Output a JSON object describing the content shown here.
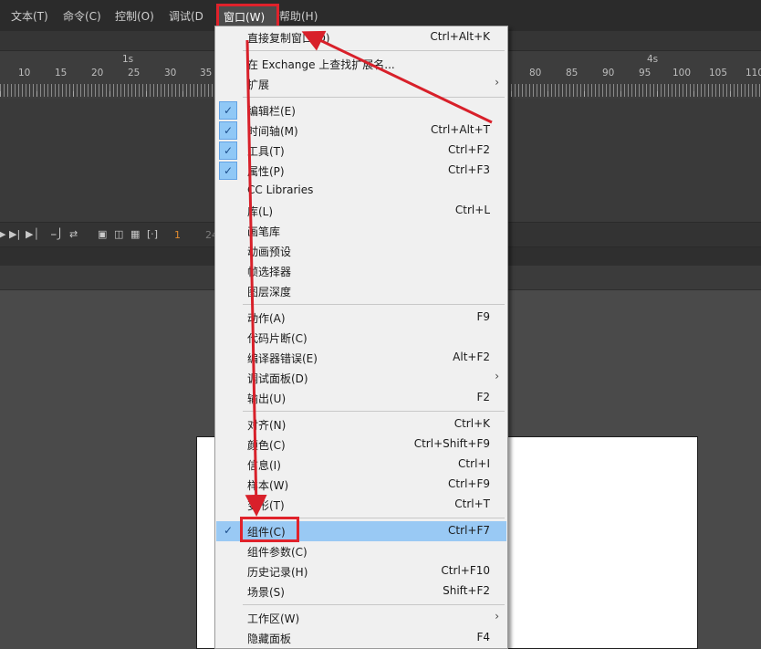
{
  "menubar": {
    "items": [
      {
        "label": "文本(T)"
      },
      {
        "label": "命令(C)"
      },
      {
        "label": "控制(O)"
      },
      {
        "label": "调试(D"
      }
    ],
    "window_label": "窗口(W)",
    "help_label": "帮助(H)"
  },
  "timeline": {
    "seconds": [
      "1s",
      "4s"
    ],
    "frames": [
      "10",
      "15",
      "20",
      "25",
      "30",
      "35",
      "80",
      "85",
      "90",
      "95",
      "100",
      "105",
      "110"
    ],
    "current_frame": "1",
    "fps_partial": "24"
  },
  "window_menu": {
    "items": [
      {
        "label": "直接复制窗口(D)",
        "shortcut": "Ctrl+Alt+K"
      },
      {
        "label": "在 Exchange 上查找扩展名...",
        "shortcut": ""
      },
      {
        "label": "扩展",
        "submenu": true
      },
      {
        "label": "编辑栏(E)",
        "checked": true
      },
      {
        "label": "时间轴(M)",
        "shortcut": "Ctrl+Alt+T",
        "checked": true
      },
      {
        "label": "工具(T)",
        "shortcut": "Ctrl+F2",
        "checked": true
      },
      {
        "label": "属性(P)",
        "shortcut": "Ctrl+F3",
        "checked": true
      },
      {
        "label": "CC Libraries"
      },
      {
        "label": "库(L)",
        "shortcut": "Ctrl+L"
      },
      {
        "label": "画笔库"
      },
      {
        "label": "动画预设"
      },
      {
        "label": "帧选择器"
      },
      {
        "label": "图层深度"
      },
      {
        "label": "动作(A)",
        "shortcut": "F9"
      },
      {
        "label": "代码片断(C)"
      },
      {
        "label": "编译器错误(E)",
        "shortcut": "Alt+F2"
      },
      {
        "label": "调试面板(D)",
        "submenu": true
      },
      {
        "label": "输出(U)",
        "shortcut": "F2"
      },
      {
        "label": "对齐(N)",
        "shortcut": "Ctrl+K"
      },
      {
        "label": "颜色(C)",
        "shortcut": "Ctrl+Shift+F9"
      },
      {
        "label": "信息(I)",
        "shortcut": "Ctrl+I"
      },
      {
        "label": "样本(W)",
        "shortcut": "Ctrl+F9"
      },
      {
        "label": "变形(T)",
        "shortcut": "Ctrl+T"
      },
      {
        "label": "组件(C)",
        "shortcut": "Ctrl+F7",
        "checked": true,
        "highlighted": true
      },
      {
        "label": "组件参数(C)"
      },
      {
        "label": "历史记录(H)",
        "shortcut": "Ctrl+F10"
      },
      {
        "label": "场景(S)",
        "shortcut": "Shift+F2"
      },
      {
        "label": "工作区(W)",
        "submenu": true
      },
      {
        "label": "隐藏面板",
        "shortcut": "F4"
      }
    ]
  },
  "colors": {
    "highlight_box": "#e0222b",
    "arrow": "#d8202a",
    "menu_highlight": "#99c9f4"
  },
  "icons": [
    "checkmark-icon",
    "submenu-arrow-icon",
    "play-icon",
    "step-back-icon",
    "step-forward-icon"
  ]
}
